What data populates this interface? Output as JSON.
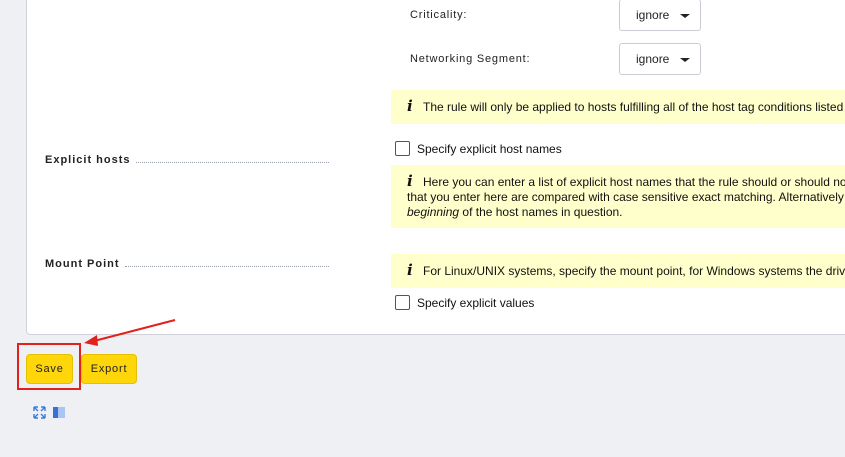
{
  "host_tags": [
    {
      "label": "Criticality:",
      "value": "ignore"
    },
    {
      "label": "Networking Segment:",
      "value": "ignore"
    }
  ],
  "host_tag_info": "The rule will only be applied to hosts fulfilling all of the host tag conditions listed",
  "explicit_hosts": {
    "title": "Explicit hosts",
    "checkbox_label": "Specify explicit host names",
    "info_line1": "Here you can enter a list of explicit host names that the rule should or should no",
    "info_line2": "that you enter here are compared with case sensitive exact matching. Alternatively",
    "info_line3_em": "beginning",
    "info_line3_rest": " of the host names in question."
  },
  "mount_point": {
    "title": "Mount Point",
    "info": "For Linux/UNIX systems, specify the mount point, for Windows systems the driv",
    "checkbox_label": "Specify explicit values"
  },
  "buttons": {
    "save": "Save",
    "export": "Export"
  },
  "icons": [
    "fullscreen-icon",
    "sidebar-toggle-icon",
    "info-icon",
    "dropdown-caret-icon"
  ],
  "colors": {
    "button_yellow": "#ffd60a",
    "info_background": "#ffffcc",
    "annotation_red": "#e3201b"
  }
}
